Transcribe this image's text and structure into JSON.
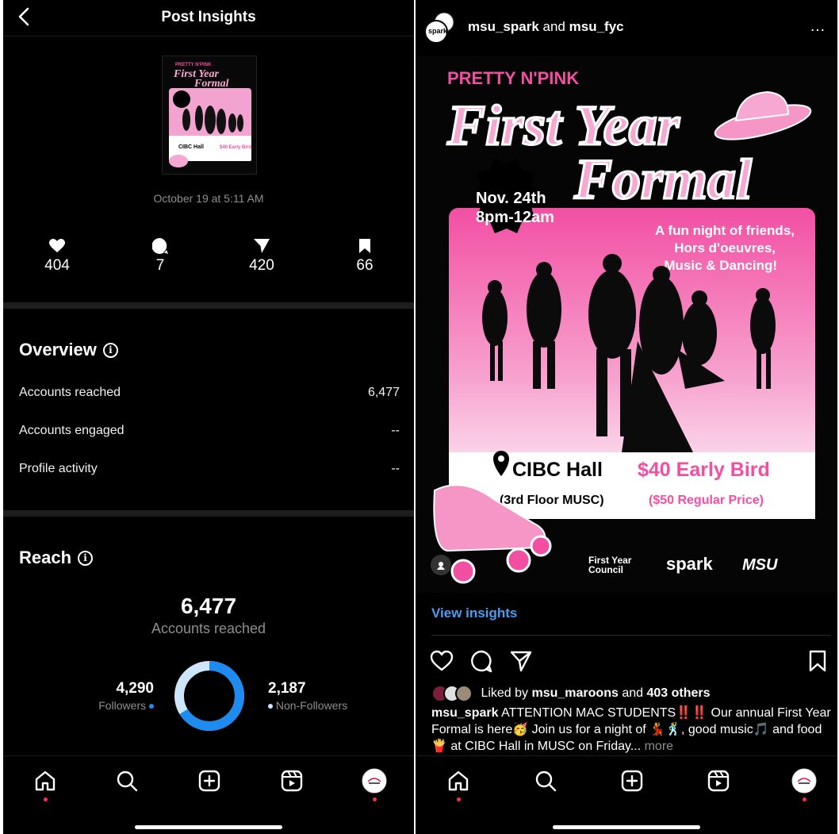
{
  "insights": {
    "title": "Post Insights",
    "date": "October 19 at 5:11 AM",
    "stats": [
      {
        "icon": "heart-icon",
        "value": "404"
      },
      {
        "icon": "comment-icon",
        "value": "7"
      },
      {
        "icon": "share-icon",
        "value": "420"
      },
      {
        "icon": "bookmark-icon",
        "value": "66"
      }
    ],
    "overview": {
      "title": "Overview",
      "rows": [
        {
          "label": "Accounts reached",
          "value": "6,477"
        },
        {
          "label": "Accounts engaged",
          "value": "--"
        },
        {
          "label": "Profile activity",
          "value": "--"
        }
      ]
    },
    "reach": {
      "title": "Reach",
      "total": "6,477",
      "total_label": "Accounts reached",
      "followers": "4,290",
      "followers_label": "Followers",
      "non_followers": "2,187",
      "non_followers_label": "Non-Followers",
      "followers_fraction": 0.662
    }
  },
  "colors": {
    "accent_blue": "#1d8bf0",
    "light_blue": "#cde6fb",
    "link_blue": "#4a9df0",
    "pink": "#f24fa3",
    "red_dot": "#ff3040"
  },
  "post": {
    "users": "msu_spark",
    "and_text": "and",
    "collab_user": "msu_fyc",
    "more_icon": "…",
    "avatar_text": "spark",
    "flyer": {
      "tag": "PRETTY N'PINK",
      "title_line1": "First Year",
      "title_line2": "Formal",
      "date_line1": "Nov. 24th",
      "date_line2": "8pm-12am",
      "desc_line1": "A fun night of friends,",
      "desc_line2": "Hors d'oeuvres,",
      "desc_line3": "Music & Dancing!",
      "venue": "CIBC Hall",
      "venue_sub": "(3rd Floor MUSC)",
      "price": "$40 Early Bird",
      "price_sub": "($50 Regular Price)"
    },
    "view_insights": "View insights",
    "liked_prefix": "Liked by",
    "liked_user": "msu_maroons",
    "liked_and": "and",
    "liked_others": "403 others",
    "caption_user": "msu_spark",
    "caption_text": "ATTENTION MAC STUDENTS‼️‼️ Our annual First Year Formal is here🥳 Join us for a night of 💃🕺, good music🎵 and food🍟 at CIBC Hall in MUSC on Friday...",
    "caption_more": "more"
  }
}
